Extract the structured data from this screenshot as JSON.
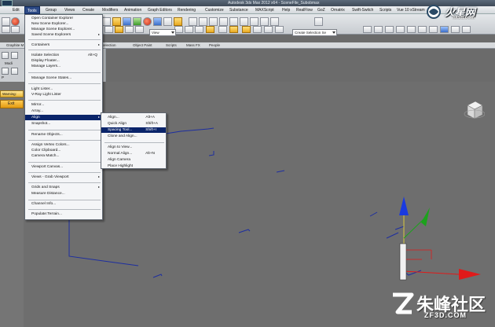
{
  "window": {
    "title": "Autodesk 3ds Max 2012 x64 - SceneFile_Subobmax"
  },
  "menubar": {
    "items": [
      "Edit",
      "Tools",
      "Group",
      "Views",
      "Create",
      "Modifiers",
      "Animation",
      "Graph Editors",
      "Rendering",
      "Customize",
      "Substance",
      "MAXScript",
      "Help",
      "RealFlow",
      "GoZ",
      "Ornatrix",
      "Swift-Switch",
      "Scripts",
      "Vue 10 xStream"
    ]
  },
  "toolbar": {
    "view_dropdown": "View",
    "selection_set_dropdown": "Create Selection Se"
  },
  "ribbon": {
    "tabs": [
      "Graphite M",
      "Selection",
      "Object Paint",
      "Scripts",
      "Mass FX",
      "People"
    ],
    "strip_label_1": "Modi",
    "strip_label_2": "P"
  },
  "warning": {
    "label": "Warning:",
    "exit_label": "Exit"
  },
  "tools_menu": {
    "items": [
      {
        "label": "Open Container Explorer",
        "shortcut": "",
        "submenu": false
      },
      {
        "label": "New Scene Explorer...",
        "shortcut": "",
        "submenu": false
      },
      {
        "label": "Manage Scene Explorer...",
        "shortcut": "",
        "submenu": false
      },
      {
        "label": "Saved Scene Explorers",
        "shortcut": "",
        "submenu": true
      },
      {
        "label": "Containers",
        "shortcut": "",
        "submenu": true
      },
      {
        "label": "Isolate Selection",
        "shortcut": "Alt+Q",
        "submenu": false
      },
      {
        "label": "Display Floater...",
        "shortcut": "",
        "submenu": false
      },
      {
        "label": "Manage Layers...",
        "shortcut": "",
        "submenu": false
      },
      {
        "label": "Manage Scene States...",
        "shortcut": "",
        "submenu": false
      },
      {
        "label": "Light Lister...",
        "shortcut": "",
        "submenu": false
      },
      {
        "label": "V-Ray Light Lister",
        "shortcut": "",
        "submenu": false
      },
      {
        "label": "Mirror...",
        "shortcut": "",
        "submenu": false
      },
      {
        "label": "Array...",
        "shortcut": "",
        "submenu": false
      },
      {
        "label": "Align",
        "shortcut": "",
        "submenu": true
      },
      {
        "label": "Snapshot...",
        "shortcut": "",
        "submenu": false
      },
      {
        "label": "Rename Objects...",
        "shortcut": "",
        "submenu": false
      },
      {
        "label": "Assign Vertex Colors...",
        "shortcut": "",
        "submenu": false
      },
      {
        "label": "Color Clipboard...",
        "shortcut": "",
        "submenu": false
      },
      {
        "label": "Camera Match...",
        "shortcut": "",
        "submenu": false
      },
      {
        "label": "Viewport Canvas...",
        "shortcut": "",
        "submenu": false
      },
      {
        "label": "Views - Grab Viewport",
        "shortcut": "",
        "submenu": true
      },
      {
        "label": "Grids and Snaps",
        "shortcut": "",
        "submenu": true
      },
      {
        "label": "Measure Distance...",
        "shortcut": "",
        "submenu": false
      },
      {
        "label": "Channel Info...",
        "shortcut": "",
        "submenu": false
      },
      {
        "label": "Populate:Terrain...",
        "shortcut": "",
        "submenu": false
      }
    ]
  },
  "align_submenu": {
    "items": [
      {
        "label": "Align...",
        "shortcut": "Alt+A"
      },
      {
        "label": "Quick Align",
        "shortcut": "Shift+A"
      },
      {
        "label": "Spacing Tool...",
        "shortcut": "Shift+I"
      },
      {
        "label": "Clone and Align...",
        "shortcut": ""
      },
      {
        "label": "Align to View...",
        "shortcut": ""
      },
      {
        "label": "Normal Align...",
        "shortcut": "Alt+N"
      },
      {
        "label": "Align Camera",
        "shortcut": ""
      },
      {
        "label": "Place Highlight",
        "shortcut": ""
      }
    ]
  },
  "watermarks": {
    "top_brand": "火星网",
    "top_url": "hxsd.com",
    "bottom_brand": "朱峰社区",
    "bottom_url": "ZF3D.COM"
  },
  "colors": {
    "menu_highlight": "#0a246a",
    "viewport_bg": "#6e6e6e",
    "spline": "#1d2ea0",
    "gizmo_x": "#e01a1a",
    "gizmo_y": "#1ca21c",
    "gizmo_z": "#1a3ae0",
    "selection_tab": "#2d4a86"
  }
}
